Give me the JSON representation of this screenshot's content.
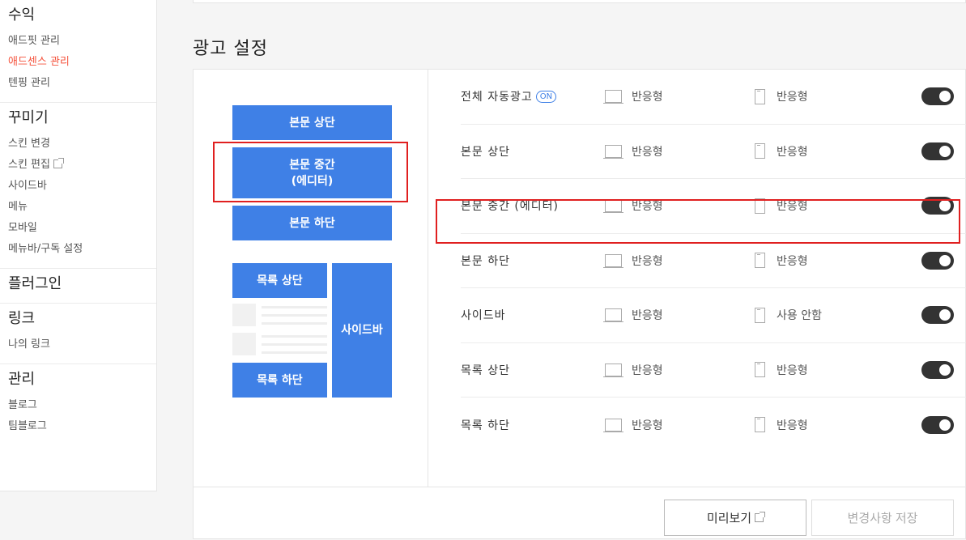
{
  "sidebar": {
    "groups": [
      {
        "title": "수익",
        "items": [
          "애드핏 관리",
          "애드센스 관리",
          "텐핑 관리"
        ]
      },
      {
        "title": "꾸미기",
        "items": [
          "스킨 변경",
          "스킨 편집",
          "사이드바",
          "메뉴",
          "모바일",
          "메뉴바/구독 설정"
        ]
      },
      {
        "title": "플러그인",
        "items": []
      },
      {
        "title": "링크",
        "items": [
          "나의 링크"
        ]
      },
      {
        "title": "관리",
        "items": [
          "블로그",
          "팀블로그"
        ]
      }
    ]
  },
  "section_title": "광고 설정",
  "preview": {
    "body_top": "본문 상단",
    "body_mid_line1": "본문 중간",
    "body_mid_line2": "(에디터)",
    "body_bottom": "본문 하단",
    "list_top": "목록 상단",
    "list_bottom": "목록 하단",
    "side": "사이드바"
  },
  "rows": [
    {
      "label": "전체 자동광고",
      "badge": "ON",
      "pc": "반응형",
      "mobile": "반응형",
      "enabled": true
    },
    {
      "label": "본문 상단",
      "pc": "반응형",
      "mobile": "반응형",
      "enabled": true
    },
    {
      "label": "본문 중간 (에디터)",
      "pc": "반응형",
      "mobile": "반응형",
      "enabled": true
    },
    {
      "label": "본문 하단",
      "pc": "반응형",
      "mobile": "반응형",
      "enabled": true
    },
    {
      "label": "사이드바",
      "pc": "반응형",
      "mobile": "사용 안함",
      "enabled": true
    },
    {
      "label": "목록 상단",
      "pc": "반응형",
      "mobile": "반응형",
      "enabled": true
    },
    {
      "label": "목록 하단",
      "pc": "반응형",
      "mobile": "반응형",
      "enabled": true
    }
  ],
  "footer": {
    "preview_label": "미리보기",
    "save_label": "변경사항 저장"
  },
  "colors": {
    "accent": "#3f80e6",
    "active_menu": "#f5533d",
    "highlight": "#e02020"
  }
}
